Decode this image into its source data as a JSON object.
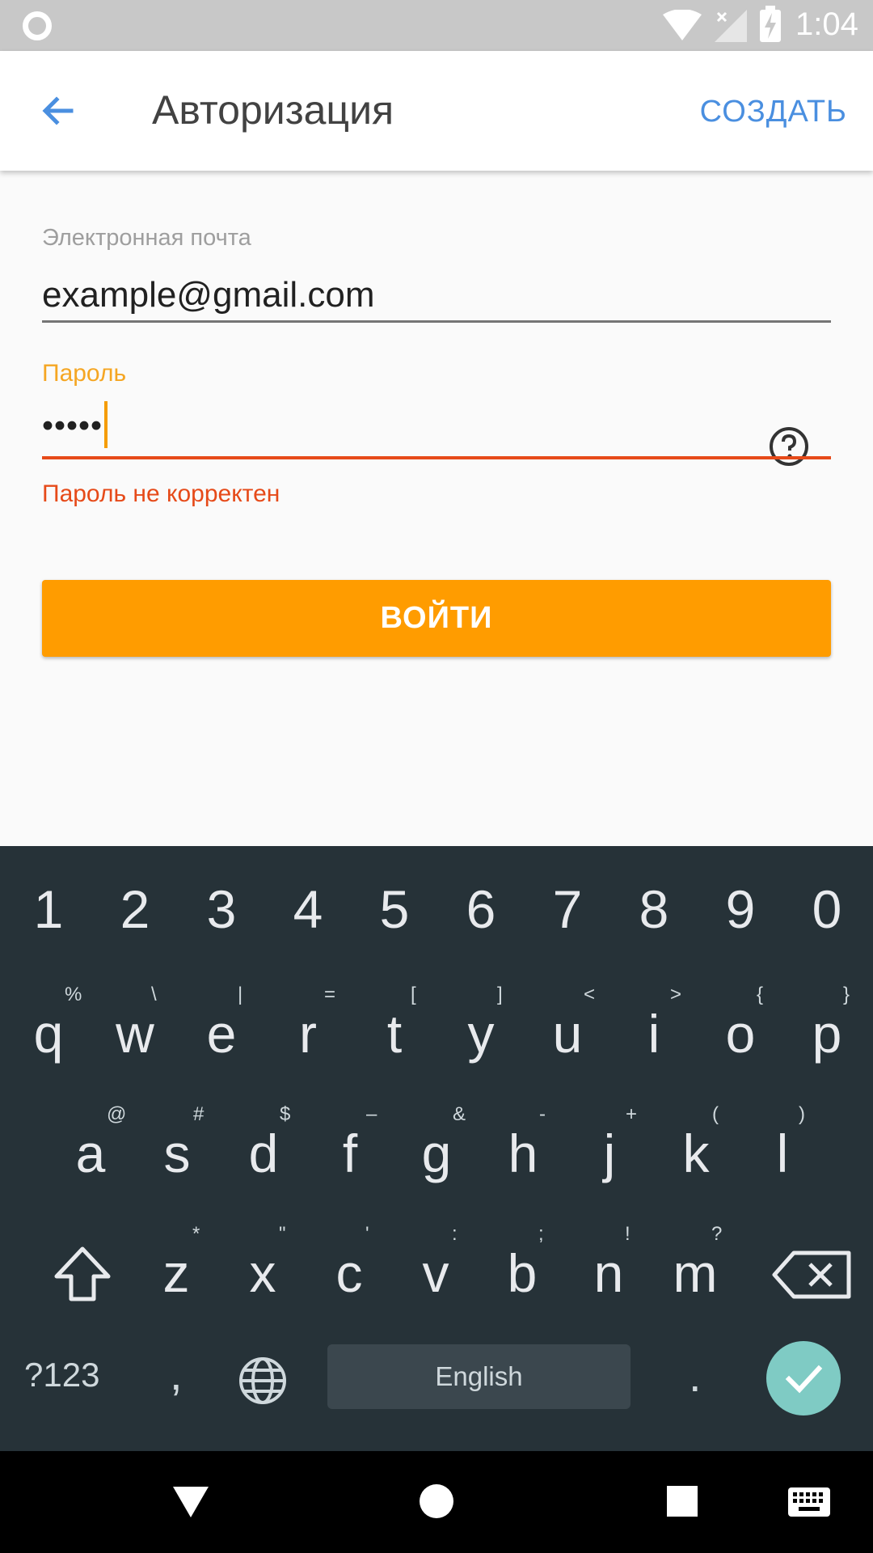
{
  "status_bar": {
    "time": "1:04",
    "icons": [
      "circle-indicator-icon",
      "wifi-icon",
      "signal-icon",
      "battery-charging-icon"
    ]
  },
  "app_bar": {
    "back_icon": "arrow-left-icon",
    "title": "Авторизация",
    "create_label": "СОЗДАТЬ"
  },
  "form": {
    "email_label": "Электронная почта",
    "email_value": "example@gmail.com",
    "password_label": "Пароль",
    "password_value": "•••••",
    "password_error": "Пароль не корректен",
    "help_icon": "question-circle-icon",
    "login_label": "ВОЙТИ"
  },
  "colors": {
    "accent": "#ff9c00",
    "link": "#4a8fe0",
    "error": "#e64a19",
    "keyboard_bg": "#263238",
    "enter_key": "#7fcbc4"
  },
  "keyboard": {
    "number_row": [
      "1",
      "2",
      "3",
      "4",
      "5",
      "6",
      "7",
      "8",
      "9",
      "0"
    ],
    "row1": [
      {
        "key": "q",
        "hint": "%"
      },
      {
        "key": "w",
        "hint": "\\"
      },
      {
        "key": "e",
        "hint": "|"
      },
      {
        "key": "r",
        "hint": "="
      },
      {
        "key": "t",
        "hint": "["
      },
      {
        "key": "y",
        "hint": "]"
      },
      {
        "key": "u",
        "hint": "<"
      },
      {
        "key": "i",
        "hint": ">"
      },
      {
        "key": "o",
        "hint": "{"
      },
      {
        "key": "p",
        "hint": "}"
      }
    ],
    "row2": [
      {
        "key": "a",
        "hint": "@"
      },
      {
        "key": "s",
        "hint": "#"
      },
      {
        "key": "d",
        "hint": "$"
      },
      {
        "key": "f",
        "hint": "–"
      },
      {
        "key": "g",
        "hint": "&"
      },
      {
        "key": "h",
        "hint": "-"
      },
      {
        "key": "j",
        "hint": "+"
      },
      {
        "key": "k",
        "hint": "("
      },
      {
        "key": "l",
        "hint": ")"
      }
    ],
    "row3": [
      {
        "key": "z",
        "hint": "*"
      },
      {
        "key": "x",
        "hint": "\""
      },
      {
        "key": "c",
        "hint": "'"
      },
      {
        "key": "v",
        "hint": ":"
      },
      {
        "key": "b",
        "hint": ";"
      },
      {
        "key": "n",
        "hint": "!"
      },
      {
        "key": "m",
        "hint": "?"
      }
    ],
    "symbols_label": "?123",
    "comma": ",",
    "space_label": "English",
    "period": ".",
    "icons": [
      "shift-icon",
      "backspace-icon",
      "globe-icon",
      "checkmark-icon"
    ]
  },
  "nav_bar": {
    "icons": [
      "back-triangle-icon",
      "home-circle-icon",
      "recents-square-icon",
      "keyboard-icon"
    ]
  }
}
